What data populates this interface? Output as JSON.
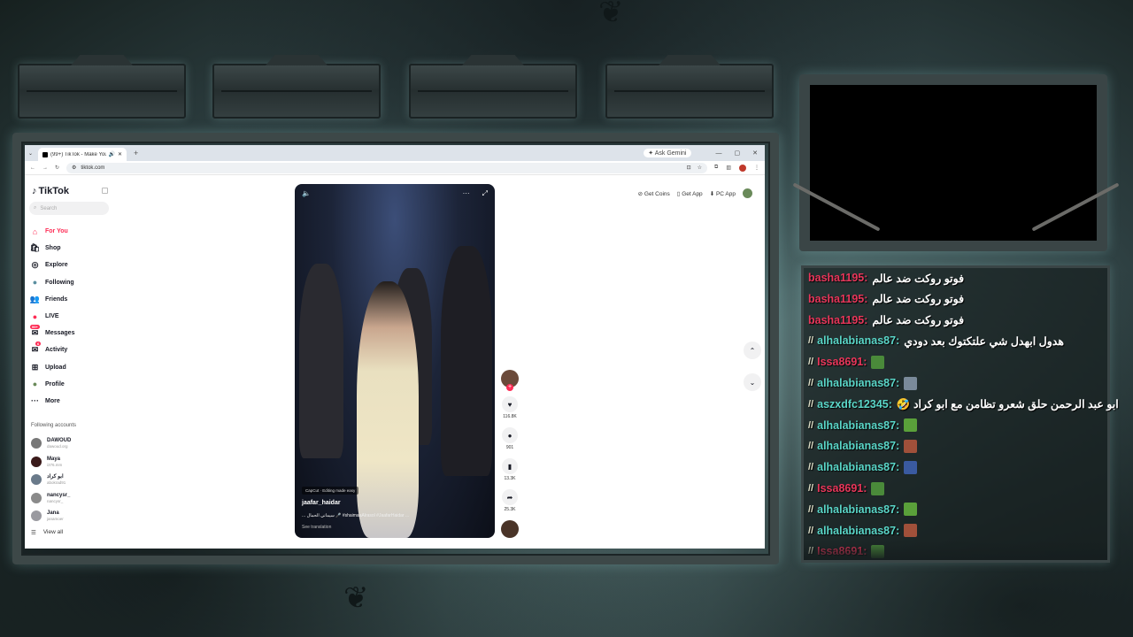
{
  "browser": {
    "tab_title": "(99+) TikTok - Make Your Day",
    "new_tab": "+",
    "ask_gemini": "Ask Gemini",
    "url": "tiktok.com"
  },
  "tiktok": {
    "logo": "TikTok",
    "search_placeholder": "Search",
    "nav": [
      {
        "label": "For You",
        "icon": "home-icon",
        "glyph": "⌂"
      },
      {
        "label": "Shop",
        "icon": "shop-icon",
        "glyph": "🛍"
      },
      {
        "label": "Explore",
        "icon": "compass-icon",
        "glyph": "◎"
      },
      {
        "label": "Following",
        "icon": "following-icon",
        "glyph": "●"
      },
      {
        "label": "Friends",
        "icon": "friends-icon",
        "glyph": "👥"
      },
      {
        "label": "LIVE",
        "icon": "live-icon",
        "glyph": "●"
      },
      {
        "label": "Messages",
        "icon": "messages-icon",
        "glyph": "✉"
      },
      {
        "label": "Activity",
        "icon": "activity-icon",
        "glyph": "✉"
      },
      {
        "label": "Upload",
        "icon": "upload-icon",
        "glyph": "⊞"
      },
      {
        "label": "Profile",
        "icon": "profile-icon",
        "glyph": "●"
      },
      {
        "label": "More",
        "icon": "more-icon",
        "glyph": "···"
      }
    ],
    "messages_badge": "99+",
    "activity_badge": "6",
    "following_accounts_title": "Following accounts",
    "following_accounts": [
      {
        "name": "DAWOUD",
        "handle": "dawoud.org"
      },
      {
        "name": "Maya",
        "handle": "i376.mm"
      },
      {
        "name": "ابو كراد",
        "handle": "abokrad91"
      },
      {
        "name": "nancysr_",
        "handle": "nancysr_"
      },
      {
        "name": "Jana",
        "handle": "janamoer"
      }
    ],
    "view_all": "View all",
    "top_actions": [
      "Get Coins",
      "Get App",
      "PC App"
    ],
    "video": {
      "capcut_label": "CapCut · Editing made easy",
      "username": "jaafar_haidar",
      "caption": "... سيماني الحمال 🎤 #shaimaaAlrasol #JaafarHaidar ...",
      "see_translation": "See translation"
    },
    "actions": {
      "likes": "116.8K",
      "comments": "901",
      "saves": "13.3K",
      "shares": "25.3K"
    }
  },
  "chat": {
    "messages": [
      {
        "user": "basha1195:",
        "color": "red",
        "prefix": "",
        "text": "فوتو روكت ضد عالم",
        "emote": ""
      },
      {
        "user": "basha1195:",
        "color": "red",
        "prefix": "",
        "text": "فوتو روكت ضد عالم",
        "emote": ""
      },
      {
        "user": "basha1195:",
        "color": "red",
        "prefix": "",
        "text": "فوتو روكت ضد عالم",
        "emote": ""
      },
      {
        "user": "alhalabianas87:",
        "color": "cyan",
        "prefix": "//",
        "text": "هدول ابهدل شي علتكتوك بعد دودي",
        "emote": ""
      },
      {
        "user": "Issa8691:",
        "color": "red",
        "prefix": "//",
        "text": "",
        "emote": "#4a8a3a"
      },
      {
        "user": "alhalabianas87:",
        "color": "cyan",
        "prefix": "//",
        "text": "",
        "emote": "#7a8a9a"
      },
      {
        "user": "aszxdfc12345:",
        "color": "cyan",
        "prefix": "//",
        "text": "ابو عبد الرحمن حلق شعرو تظامن مع ابو كراد 🤣",
        "emote": ""
      },
      {
        "user": "alhalabianas87:",
        "color": "cyan",
        "prefix": "//",
        "text": "",
        "emote": "#5aa03a"
      },
      {
        "user": "alhalabianas87:",
        "color": "cyan",
        "prefix": "//",
        "text": "",
        "emote": "#a0503a"
      },
      {
        "user": "alhalabianas87:",
        "color": "cyan",
        "prefix": "//",
        "text": "",
        "emote": "#3a5aa0"
      },
      {
        "user": "Issa8691:",
        "color": "red",
        "prefix": "//",
        "text": "",
        "emote": "#4a8a3a"
      },
      {
        "user": "alhalabianas87:",
        "color": "cyan",
        "prefix": "//",
        "text": "",
        "emote": "#5aa03a"
      },
      {
        "user": "alhalabianas87:",
        "color": "cyan",
        "prefix": "//",
        "text": "",
        "emote": "#a0503a"
      },
      {
        "user": "Issa8691:",
        "color": "red",
        "prefix": "//",
        "text": "",
        "emote": "#4a8a3a"
      }
    ]
  },
  "colors": {
    "tiktok_accent": "#fe2c55",
    "chat_red": "#e8365a",
    "chat_cyan": "#5ad6c8"
  }
}
